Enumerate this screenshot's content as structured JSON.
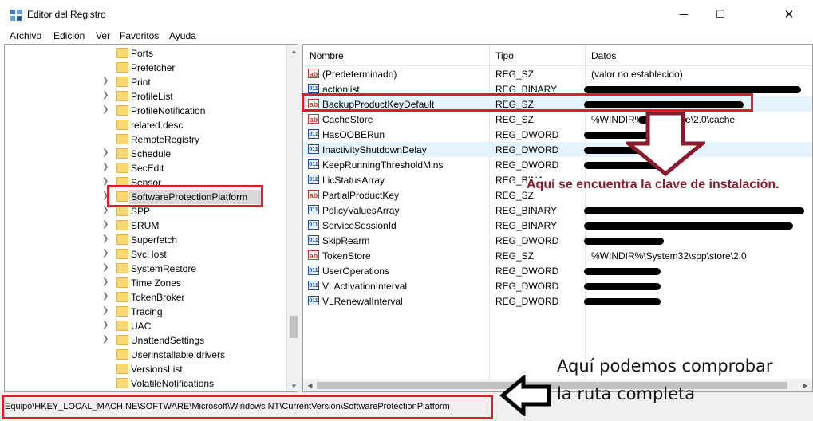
{
  "window": {
    "title": "Editor del Registro",
    "controls": {
      "minimize": "─",
      "maximize": "☐",
      "close": "✕"
    }
  },
  "menu": [
    "Archivo",
    "Edición",
    "Ver",
    "Favoritos",
    "Ayuda"
  ],
  "tree": {
    "selected": "SoftwareProtectionPlatform",
    "items": [
      {
        "label": "Ports",
        "expandable": false
      },
      {
        "label": "Prefetcher",
        "expandable": false
      },
      {
        "label": "Print",
        "expandable": true
      },
      {
        "label": "ProfileList",
        "expandable": true
      },
      {
        "label": "ProfileNotification",
        "expandable": true
      },
      {
        "label": "related.desc",
        "expandable": false
      },
      {
        "label": "RemoteRegistry",
        "expandable": false
      },
      {
        "label": "Schedule",
        "expandable": true
      },
      {
        "label": "SecEdit",
        "expandable": true
      },
      {
        "label": "Sensor",
        "expandable": true
      },
      {
        "label": "SoftwareProtectionPlatform",
        "expandable": true
      },
      {
        "label": "SPP",
        "expandable": true
      },
      {
        "label": "SRUM",
        "expandable": true
      },
      {
        "label": "Superfetch",
        "expandable": true
      },
      {
        "label": "SvcHost",
        "expandable": true
      },
      {
        "label": "SystemRestore",
        "expandable": true
      },
      {
        "label": "Time Zones",
        "expandable": true
      },
      {
        "label": "TokenBroker",
        "expandable": true
      },
      {
        "label": "Tracing",
        "expandable": true
      },
      {
        "label": "UAC",
        "expandable": true
      },
      {
        "label": "UnattendSettings",
        "expandable": true
      },
      {
        "label": "Userinstallable.drivers",
        "expandable": false
      },
      {
        "label": "VersionsList",
        "expandable": false
      },
      {
        "label": "VolatileNotifications",
        "expandable": false
      }
    ]
  },
  "list": {
    "columns": [
      "Nombre",
      "Tipo",
      "Datos"
    ],
    "rows": [
      {
        "name": "(Predeterminado)",
        "type": "REG_SZ",
        "data": "(valor no establecido)",
        "icon": "string-value-icon"
      },
      {
        "name": "actionlist",
        "type": "REG_BINARY",
        "data": "",
        "icon": "binary-value-icon"
      },
      {
        "name": "BackupProductKeyDefault",
        "type": "REG_SZ",
        "data": "",
        "icon": "string-value-icon"
      },
      {
        "name": "CacheStore",
        "type": "REG_SZ",
        "data": "%WINDIR%\\               \\spp\\store\\2.0\\cache",
        "icon": "string-value-icon"
      },
      {
        "name": "HasOOBERun",
        "type": "REG_DWORD",
        "data": "",
        "icon": "binary-value-icon"
      },
      {
        "name": "InactivityShutdownDelay",
        "type": "REG_DWORD",
        "data": "",
        "icon": "binary-value-icon"
      },
      {
        "name": "KeepRunningThresholdMins",
        "type": "REG_DWORD",
        "data": "",
        "icon": "binary-value-icon"
      },
      {
        "name": "LicStatusArray",
        "type": "REG_BINA",
        "data": "",
        "icon": "binary-value-icon"
      },
      {
        "name": "PartialProductKey",
        "type": "REG_SZ",
        "data": "",
        "icon": "string-value-icon"
      },
      {
        "name": "PolicyValuesArray",
        "type": "REG_BINARY",
        "data": "",
        "icon": "binary-value-icon"
      },
      {
        "name": "ServiceSessionId",
        "type": "REG_BINARY",
        "data": "",
        "icon": "binary-value-icon"
      },
      {
        "name": "SkipRearm",
        "type": "REG_DWORD",
        "data": "",
        "icon": "binary-value-icon"
      },
      {
        "name": "TokenStore",
        "type": "REG_SZ",
        "data": "%WINDIR%\\System32\\spp\\store\\2.0",
        "icon": "string-value-icon"
      },
      {
        "name": "UserOperations",
        "type": "REG_DWORD",
        "data": "",
        "icon": "binary-value-icon"
      },
      {
        "name": "VLActivationInterval",
        "type": "REG_DWORD",
        "data": "",
        "icon": "binary-value-icon"
      },
      {
        "name": "VLRenewalInterval",
        "type": "REG_DWORD",
        "data": "",
        "icon": "binary-value-icon"
      }
    ]
  },
  "status": {
    "path": "Equipo\\HKEY_LOCAL_MACHINE\\SOFTWARE\\Microsoft\\Windows NT\\CurrentVersion\\SoftwareProtectionPlatform"
  },
  "annotations": {
    "key_note": "Aquí se encuentra la clave de instalación.",
    "path_note_line1": "Aquí podemos comprobar",
    "path_note_line2": "la ruta completa"
  },
  "colors": {
    "highlight_box": "#d6202b",
    "annotation_text": "#8b1a2b",
    "selection": "#d9d9d9",
    "row_highlight": "#e5f3ff"
  }
}
